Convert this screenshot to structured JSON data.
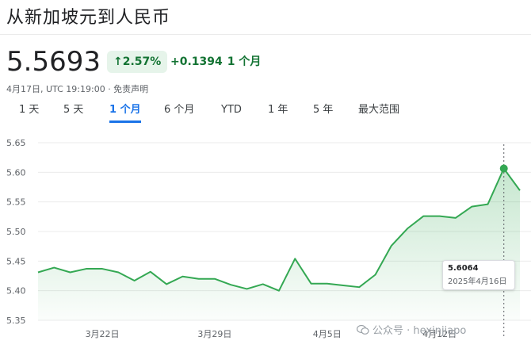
{
  "header": {
    "title": "从新加坡元到人民币",
    "price": "5.5693",
    "change_percent": "↑2.57%",
    "change_abs": "+0.1394",
    "change_period": "1 个月",
    "timestamp": "4月17日, UTC 19:19:00 · 免责声明"
  },
  "tabs": [
    {
      "label": "1 天",
      "active": false
    },
    {
      "label": "5 天",
      "active": false
    },
    {
      "label": "1 个月",
      "active": true
    },
    {
      "label": "6 个月",
      "active": false
    },
    {
      "label": "YTD",
      "active": false
    },
    {
      "label": "1 年",
      "active": false
    },
    {
      "label": "5 年",
      "active": false
    },
    {
      "label": "最大范围",
      "active": false
    }
  ],
  "tooltip": {
    "value": "5.6064",
    "date": "2025年4月16日"
  },
  "watermark": "公众号 · hexinjiapo",
  "colors": {
    "accent": "#1a73e8",
    "positive": "#137333",
    "line": "#34a853",
    "fill": "#e6f4ea"
  },
  "chart_data": {
    "type": "area",
    "y_ticks": [
      "5.65",
      "5.60",
      "5.55",
      "5.50",
      "5.45",
      "5.40",
      "5.35"
    ],
    "ylim": [
      5.35,
      5.65
    ],
    "x_ticks": [
      {
        "label": "3月22日",
        "index": 4
      },
      {
        "label": "3月29日",
        "index": 11
      },
      {
        "label": "4月5日",
        "index": 18
      },
      {
        "label": "4月12日",
        "index": 25
      }
    ],
    "values": [
      5.431,
      5.439,
      5.431,
      5.437,
      5.437,
      5.431,
      5.417,
      5.432,
      5.411,
      5.424,
      5.42,
      5.42,
      5.41,
      5.403,
      5.411,
      5.4,
      5.454,
      5.412,
      5.412,
      5.409,
      5.406,
      5.427,
      5.476,
      5.505,
      5.526,
      5.526,
      5.523,
      5.542,
      5.546,
      5.6064,
      5.5693
    ],
    "highlight_index": 29
  }
}
